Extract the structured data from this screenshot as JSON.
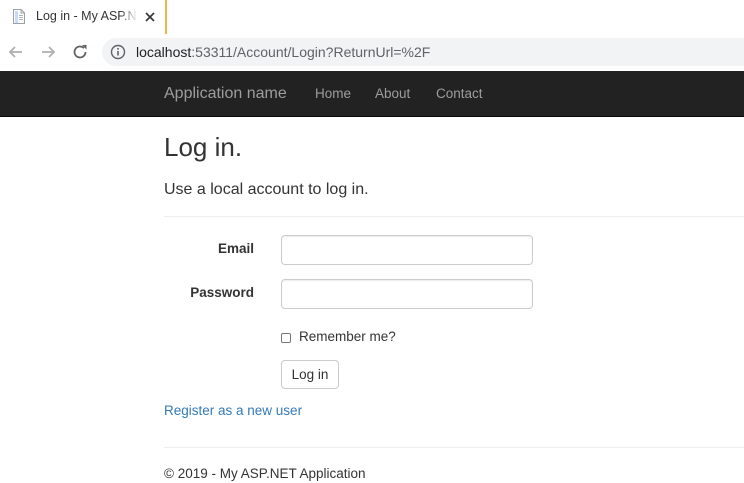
{
  "browser": {
    "tab": {
      "title": "Log in - My ASP.NET Application",
      "favicon": "document-icon"
    },
    "address_bar": {
      "host": "localhost",
      "rest": ":53311/Account/Login?ReturnUrl=%2F"
    },
    "icons": {
      "back": "arrow-left-icon",
      "forward": "arrow-right-icon",
      "reload": "reload-icon",
      "site_info": "info-icon",
      "close_tab": "close-icon"
    },
    "colors": {
      "tab_accent": "#f0b541",
      "omnibox_bg": "#f1f3f4"
    }
  },
  "navbar": {
    "brand": "Application name",
    "links": [
      {
        "label": "Home"
      },
      {
        "label": "About"
      },
      {
        "label": "Contact"
      }
    ],
    "colors": {
      "background": "#222222",
      "text": "#9d9d9d"
    }
  },
  "page": {
    "title": "Log in.",
    "subtitle": "Use a local account to log in.",
    "form": {
      "email_label": "Email",
      "email_value": "",
      "password_label": "Password",
      "password_value": "",
      "remember_label": "Remember me?",
      "remember_checked": false,
      "submit_label": "Log in"
    },
    "register_link": "Register as a new user",
    "link_color": "#337ab7"
  },
  "footer": {
    "text": "© 2019 - My ASP.NET Application"
  }
}
